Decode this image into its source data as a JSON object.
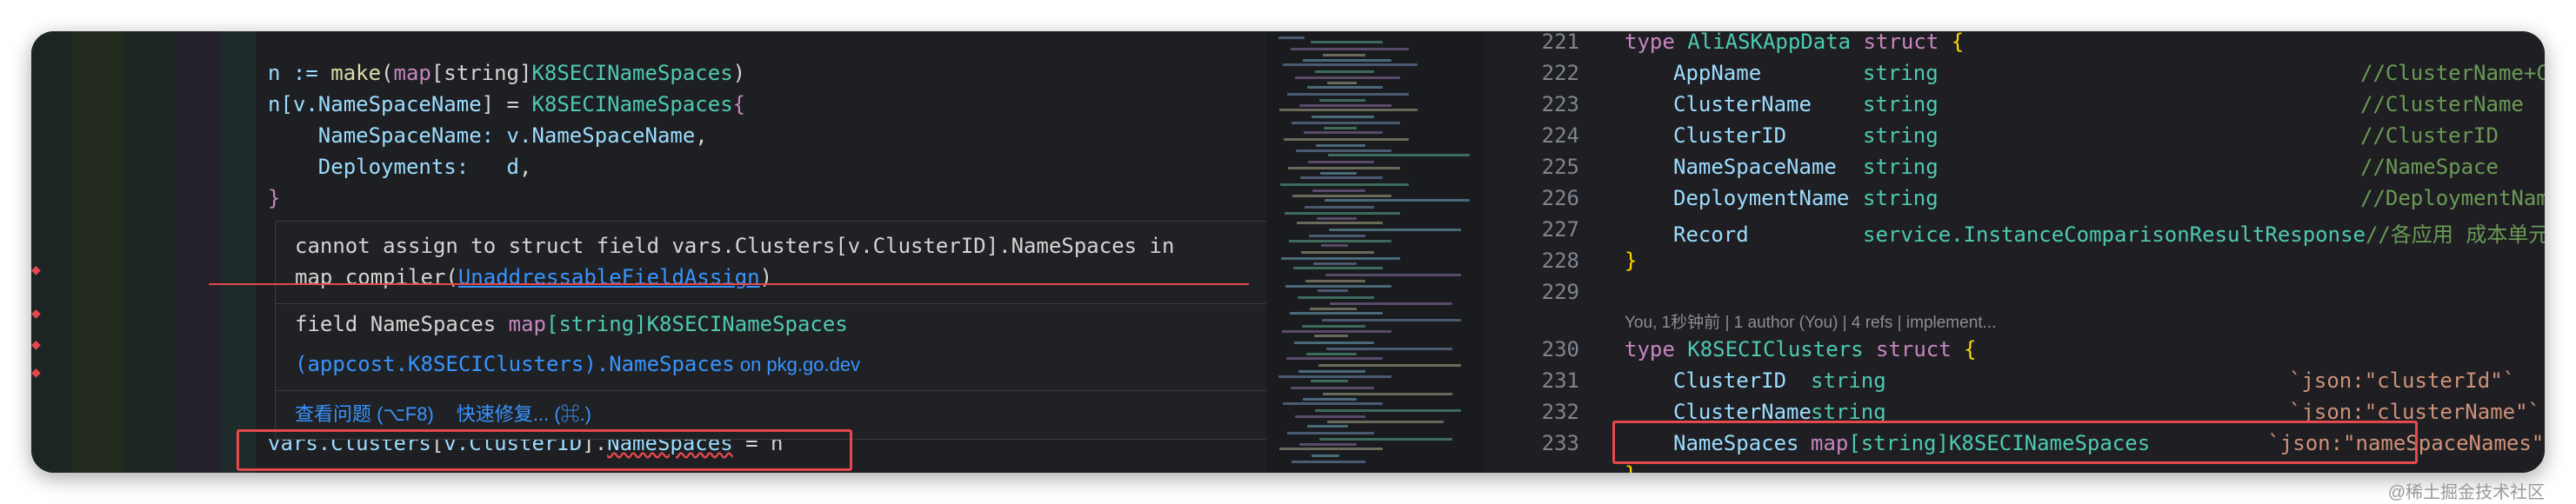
{
  "left_editor": {
    "code_lines": [
      {
        "t1": "n := ",
        "t2": "make",
        "t3": "(",
        "t4": "map",
        "t5": "[string]",
        "t6": "K8SECINameSpaces",
        ")": ")"
      },
      {
        "a": "n[",
        "b": "v.NameSpaceName",
        "c": "] = ",
        "d": "K8SECINameSpaces",
        "e": "{"
      },
      {
        "a": "    NameSpaceName: ",
        "b": "v.NameSpaceName",
        ",": ","
      },
      {
        "a": "    Deployments:   ",
        "b": "d",
        ",": ","
      },
      {
        "a": "}"
      }
    ],
    "bottom_line": {
      "a": "vars.",
      "b": "Clusters",
      "c": "[",
      "d": "v.ClusterID",
      "e": "].",
      "f": "NameSpaces",
      "g": " = n"
    }
  },
  "hover": {
    "error_line1": "cannot assign to struct field vars.Clusters[v.ClusterID].NameSpaces in",
    "error_line2_prefix": "map compiler(",
    "error_code_link": "UnaddressableFieldAssign",
    "error_line2_suffix": ")",
    "signature_prefix": "field NameSpaces ",
    "signature_type_kw": "map",
    "signature_type_rest": "[string]K8SECINameSpaces",
    "doc_link": "(appcost.K8SECIClusters).NameSpaces",
    "doc_suffix": " on pkg.go.dev",
    "action_view_problem": "查看问题 (⌥F8)",
    "action_quick_fix": "快速修复... (⌘.)"
  },
  "right_editor": {
    "line_numbers": [
      "221",
      "222",
      "223",
      "224",
      "225",
      "226",
      "227",
      "228",
      "229",
      "230",
      "231",
      "232",
      "233"
    ],
    "struct1": {
      "header_kw": "type",
      "header_name": "AliASKAppData",
      "header_struct": "struct",
      "fields": [
        {
          "name": "AppName",
          "type": "string",
          "comment": "//ClusterName+Cl"
        },
        {
          "name": "ClusterName",
          "type": "string",
          "comment": "//ClusterName"
        },
        {
          "name": "ClusterID",
          "type": "string",
          "comment": "//ClusterID"
        },
        {
          "name": "NameSpaceName",
          "type": "string",
          "comment": "//NameSpace"
        },
        {
          "name": "DeploymentName",
          "type": "string",
          "comment": "//DeploymentName"
        },
        {
          "name": "Record",
          "type": "service.InstanceComparisonResultResponse",
          "comment": "//各应用 成本单元、"
        }
      ],
      "close": "}"
    },
    "codelens": "You, 1秒钟前 | 1 author (You) | 4 refs | implement...",
    "struct2": {
      "header_kw": "type",
      "header_name": "K8SECIClusters",
      "header_struct": "struct",
      "fields": [
        {
          "name": "ClusterID",
          "type": "string",
          "tag": "`json:\"clusterId\"`"
        },
        {
          "name": "ClusterName",
          "type": "string",
          "tag": "`json:\"clusterName\"`"
        },
        {
          "name": "NameSpaces",
          "type_kw": "map",
          "type_rest": "[string]K8SECINameSpaces",
          "tag": "`json:\"nameSpaceNames\"`"
        }
      ]
    }
  },
  "watermark": "@稀土掘金技术社区",
  "colors": {
    "error": "#e5484d",
    "keyword": "#c586c0",
    "type": "#4ec9b0",
    "link": "#3794ff"
  }
}
